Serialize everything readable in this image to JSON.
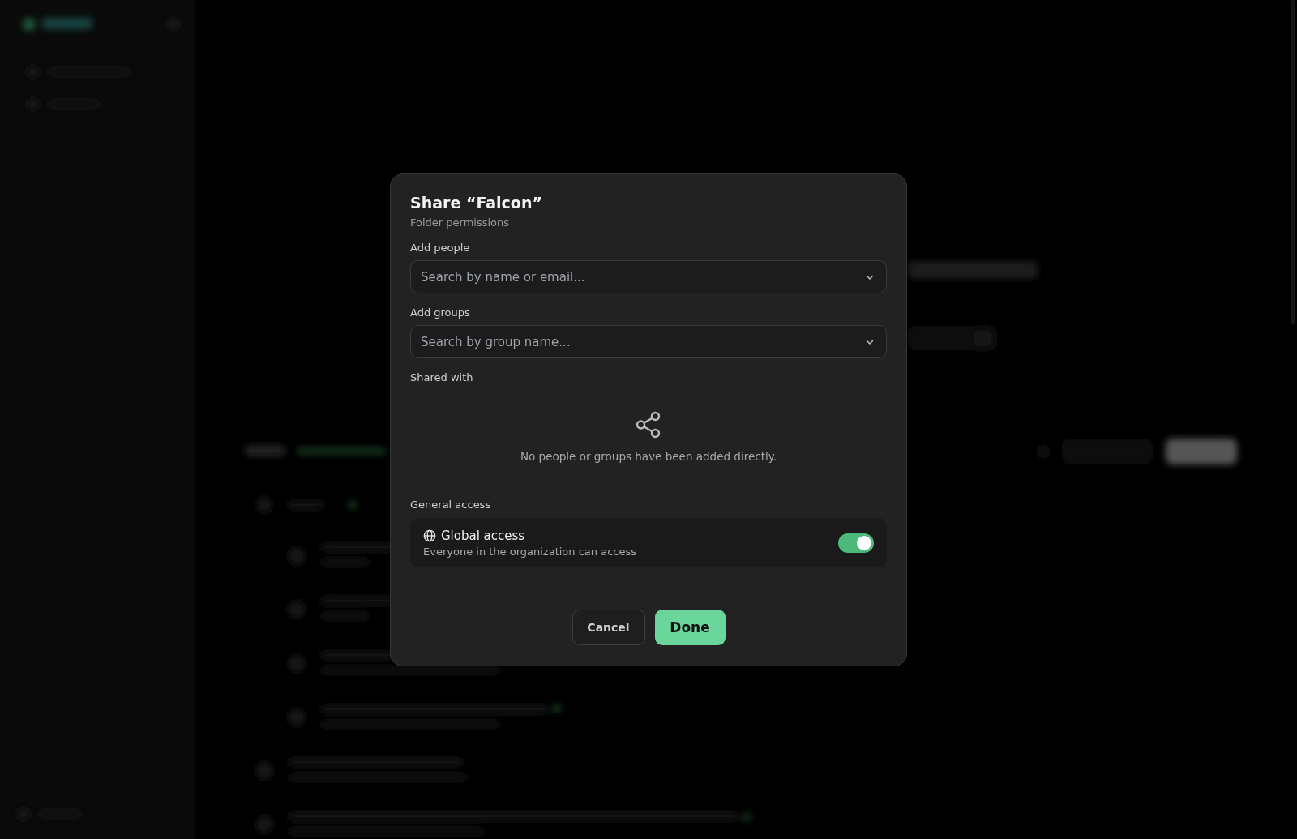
{
  "dialog": {
    "title": "Share “Falcon”",
    "subtitle": "Folder permissions",
    "people": {
      "label": "Add people",
      "placeholder": "Search by name or email..."
    },
    "groups": {
      "label": "Add groups",
      "placeholder": "Search by group name..."
    },
    "shared_with": {
      "label": "Shared with",
      "empty_text": "No people or groups have been added directly."
    },
    "general_access": {
      "label": "General access",
      "title": "Global access",
      "description": "Everyone in the organization can access",
      "on": true
    },
    "buttons": [
      {
        "label": "Cancel",
        "kind": "secondary"
      },
      {
        "label": "Done",
        "kind": "primary"
      }
    ]
  }
}
